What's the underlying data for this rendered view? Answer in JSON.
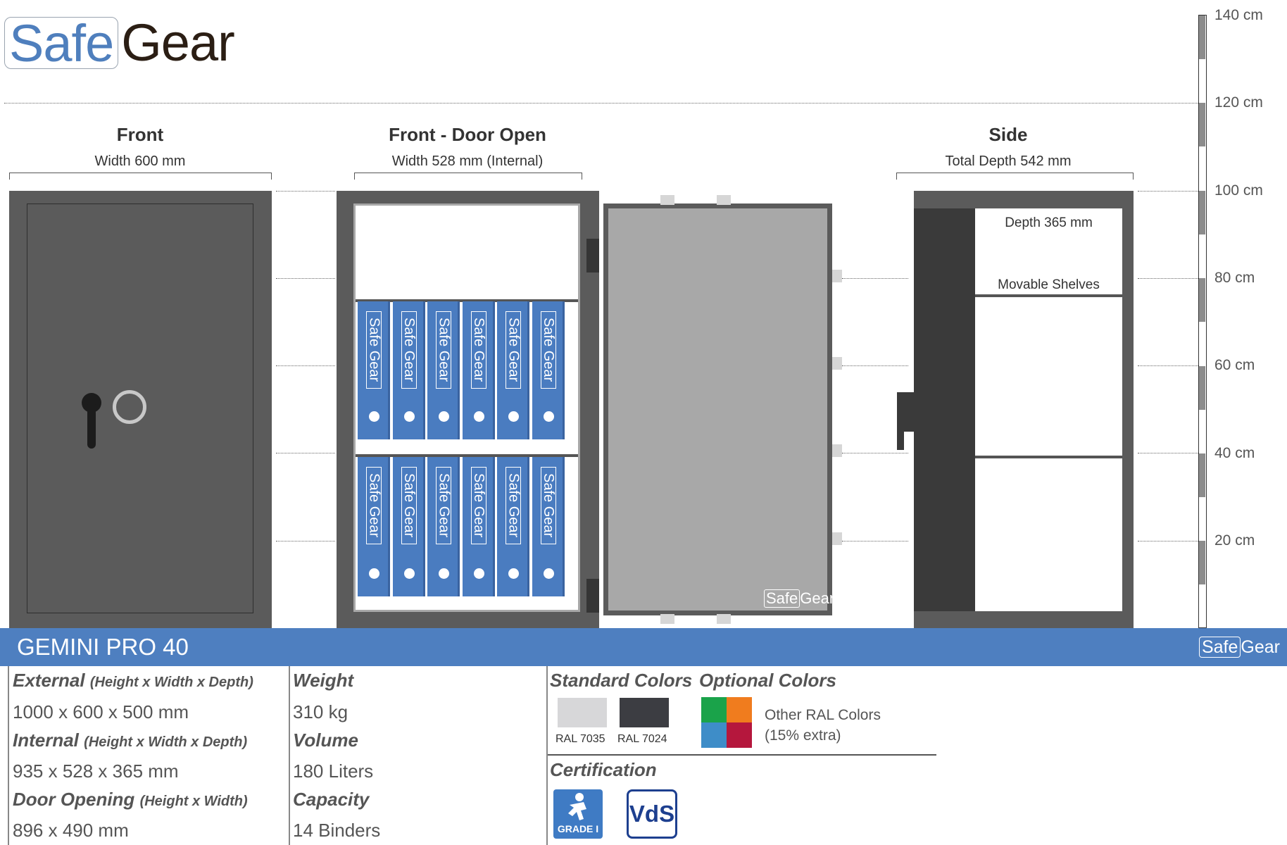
{
  "brand": {
    "part1": "Safe",
    "part2": "Gear"
  },
  "views": {
    "front": {
      "title": "Front",
      "subtitle": "Width 600 mm"
    },
    "door_open": {
      "title": "Front - Door Open",
      "subtitle": "Width 528 mm (Internal)"
    },
    "side": {
      "title": "Side",
      "subtitle": "Total Depth 542 mm",
      "depth_label": "Depth 365 mm",
      "shelves_label": "Movable Shelves"
    }
  },
  "scale": [
    "140 cm",
    "120 cm",
    "100 cm",
    "80 cm",
    "60 cm",
    "40 cm",
    "20 cm"
  ],
  "binder_text": "Safe Gear",
  "door_logo": {
    "part1": "Safe",
    "part2": "Gear"
  },
  "banner": {
    "product": "GEMINI PRO 40",
    "logo_part1": "Safe",
    "logo_part2": "Gear"
  },
  "specs": {
    "external": {
      "label": "External",
      "sub": "(Height x Width x Depth)",
      "value": "1000 x 600 x 500 mm"
    },
    "internal": {
      "label": "Internal",
      "sub": "(Height x Width x Depth)",
      "value": "935 x 528 x 365 mm"
    },
    "door": {
      "label": "Door Opening",
      "sub": "(Height x Width)",
      "value": "896 x 490 mm"
    },
    "weight": {
      "label": "Weight",
      "value": "310 kg"
    },
    "volume": {
      "label": "Volume",
      "value": "180 Liters"
    },
    "capacity": {
      "label": "Capacity",
      "value": "14 Binders"
    }
  },
  "colors": {
    "standard_label": "Standard Colors",
    "optional_label": "Optional Colors",
    "standard": [
      {
        "name": "RAL 7035",
        "hex": "#d7d7d9"
      },
      {
        "name": "RAL 7024",
        "hex": "#3c3d42"
      }
    ],
    "optional_text_1": "Other RAL Colors",
    "optional_text_2": "(15% extra)",
    "optional_swatches": [
      "#1aa34a",
      "#f07c1e",
      "#3e8dc8",
      "#b5173d"
    ]
  },
  "certification": {
    "label": "Certification",
    "grade": "GRADE I",
    "vds": "VdS"
  },
  "palette": {
    "accent": "#4e7fc0",
    "body_dark": "#5b5b5b",
    "binder": "#4a7cc0"
  }
}
